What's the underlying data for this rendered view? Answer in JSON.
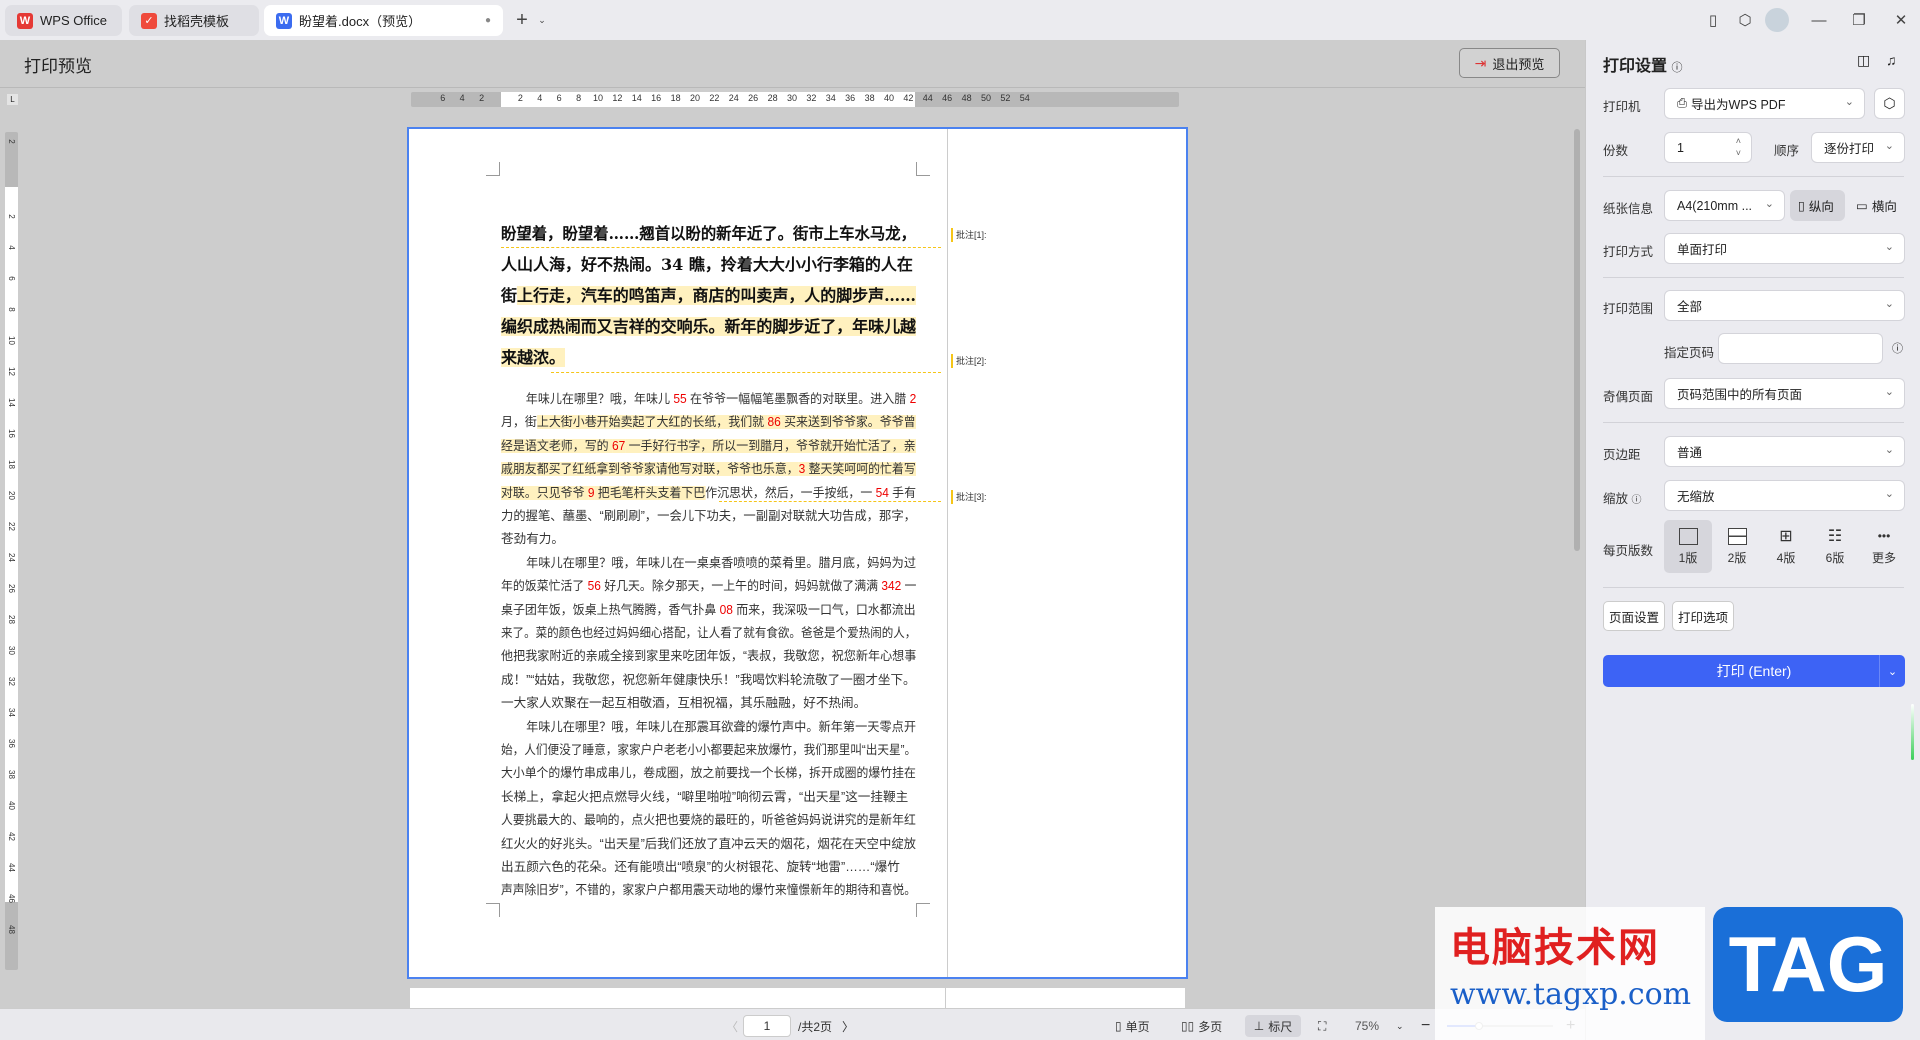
{
  "tabs": [
    {
      "label": "WPS Office",
      "icon": "wps-logo-icon"
    },
    {
      "label": "找稻壳模板",
      "icon": "docer-icon"
    },
    {
      "label": "盼望着.docx（预览）",
      "icon": "word-doc-icon",
      "active": true
    }
  ],
  "header": {
    "title": "打印预览",
    "exit_label": "退出预览"
  },
  "ruler": {
    "h_left": [
      "6",
      "4",
      "2"
    ],
    "h_main": [
      "2",
      "4",
      "6",
      "8",
      "10",
      "12",
      "14",
      "16",
      "18",
      "20",
      "22",
      "24",
      "26",
      "28",
      "30",
      "32",
      "34"
    ],
    "h_right": [
      "36",
      "38",
      "40",
      "42",
      "44",
      "46",
      "48",
      "50",
      "52",
      "54"
    ],
    "v_top": [
      "2"
    ],
    "v_main": [
      "2",
      "4",
      "6",
      "8",
      "10",
      "12",
      "14",
      "16",
      "18",
      "20",
      "22",
      "24",
      "26",
      "28",
      "30",
      "32",
      "34",
      "36",
      "38",
      "40",
      "42",
      "44",
      "46",
      "48"
    ]
  },
  "document": {
    "title_lines": [
      [
        [
          "盼望着，盼望着……翘首以盼的新年近了。街市上车水马龙，",
          ""
        ]
      ],
      [
        [
          "人山人海，好不热闹。34 瞧，拎着大大小小行李箱的人在",
          ""
        ]
      ],
      [
        [
          "街",
          ""
        ],
        [
          "上行走，汽车的鸣笛声，商店的叫卖声，人的脚步声……",
          "h"
        ]
      ],
      [
        [
          "编织成热闹而又吉祥的交响乐。新年的脚步近了，年味儿越",
          "h"
        ]
      ],
      [
        [
          "来越浓。",
          "h"
        ]
      ]
    ],
    "body_lines": [
      {
        "indent": true,
        "seg": [
          [
            "年味儿在哪里？哦，年味儿 ",
            ""
          ],
          [
            "55",
            "r"
          ],
          [
            " 在爷爷一幅幅笔墨飘香的对联里。进入腊 ",
            ""
          ],
          [
            "2",
            "r"
          ]
        ]
      },
      {
        "seg": [
          [
            "月，街",
            ""
          ],
          [
            "上大街小巷开始卖起了大红的长纸，我们就 ",
            "h"
          ],
          [
            "86",
            "rh"
          ],
          [
            " 买来送到爷爷家。爷爷曾",
            "h"
          ]
        ]
      },
      {
        "seg": [
          [
            "经是语文老师，写的 ",
            "h"
          ],
          [
            "67",
            "rh"
          ],
          [
            " 一手好行书字，所以一到腊月，爷爷就开始忙活了，亲",
            "h"
          ]
        ]
      },
      {
        "seg": [
          [
            "戚朋友都买了红纸拿到爷爷家请他写对联，爷爷也乐意，",
            "h"
          ],
          [
            "3",
            "rh"
          ],
          [
            " 整天笑呵呵的忙着写",
            "h"
          ]
        ]
      },
      {
        "seg": [
          [
            "对联。只见爷爷 ",
            "h"
          ],
          [
            "9",
            "rh"
          ],
          [
            " 把毛笔杆头支着下巴",
            "h"
          ],
          [
            "作沉思状，然后，一手按纸，一 ",
            ""
          ],
          [
            "54",
            "r"
          ],
          [
            " 手有",
            ""
          ]
        ]
      },
      {
        "seg": [
          [
            "力的握笔、蘸墨、“刷刷刷”，一会儿下功夫，一副副对联就大功告成，那字，",
            ""
          ]
        ]
      },
      {
        "last": true,
        "seg": [
          [
            "苍劲有力。",
            ""
          ]
        ]
      },
      {
        "indent": true,
        "seg": [
          [
            "年味儿在哪里？哦，年味儿在一桌桌香喷喷的菜肴里。腊月底，妈妈为过",
            ""
          ]
        ]
      },
      {
        "seg": [
          [
            "年的饭菜忙活了 ",
            ""
          ],
          [
            "56",
            "r"
          ],
          [
            " 好几天。除夕那天，一上午的时间，妈妈就做了满满 ",
            ""
          ],
          [
            "342",
            "r"
          ],
          [
            " 一",
            ""
          ]
        ]
      },
      {
        "seg": [
          [
            "桌子团年饭，饭桌上热气腾腾，香气扑鼻 ",
            ""
          ],
          [
            "08",
            "r"
          ],
          [
            " 而来，我深吸一口气，口水都流出",
            ""
          ]
        ]
      },
      {
        "seg": [
          [
            "来了。菜的颜色也经过妈妈细心搭配，让人看了就有食欲。爸爸是个爱热闹的人，",
            ""
          ]
        ]
      },
      {
        "seg": [
          [
            "他把我家附近的亲戚全接到家里来吃团年饭，“表叔，我敬您，祝您新年心想事",
            ""
          ]
        ]
      },
      {
        "seg": [
          [
            "成！”“姑姑，我敬您，祝您新年健康快乐！”我喝饮料轮流敬了一圈才坐下。",
            ""
          ]
        ]
      },
      {
        "last": true,
        "seg": [
          [
            "一大家人欢聚在一起互相敬酒，互相祝福，其乐融融，好不热闹。",
            ""
          ]
        ]
      },
      {
        "indent": true,
        "seg": [
          [
            "年味儿在哪里？哦，年味儿在那震耳欲聋的爆竹声中。新年第一天零点开",
            ""
          ]
        ]
      },
      {
        "seg": [
          [
            "始，人们便没了睡意，家家户户老老小小都要起来放爆竹，我们那里叫“出天星”。",
            ""
          ]
        ]
      },
      {
        "seg": [
          [
            "大小单个的爆竹串成串儿，卷成圈，放之前要找一个长梯，拆开成圈的爆竹挂在",
            ""
          ]
        ]
      },
      {
        "seg": [
          [
            "长梯上，拿起火把点燃导火线，“噼里啪啦”响彻云霄，“出天星”这一挂鞭主",
            ""
          ]
        ]
      },
      {
        "seg": [
          [
            "人要挑最大的、最响的，点火把也要烧的最旺的，听爸爸妈妈说讲究的是新年红",
            ""
          ]
        ]
      },
      {
        "seg": [
          [
            "红火火的好兆头。“出天星”后我们还放了直冲云天的烟花，烟花在天空中绽放",
            ""
          ]
        ]
      },
      {
        "seg": [
          [
            "出五颜六色的花朵。还有能喷出“喷泉”的火树银花、旋转“地雷”……“爆竹",
            ""
          ]
        ]
      },
      {
        "seg": [
          [
            "声声除旧岁”，不错的，家家户户都用震天动地的爆竹来憧憬新年的期待和喜悦。",
            ""
          ]
        ]
      }
    ],
    "comments": [
      "批注[1]:",
      "批注[2]:",
      "批注[3]:"
    ]
  },
  "status": {
    "page_value": "1",
    "page_total": "/共2页",
    "single_label": "单页",
    "multi_label": "多页",
    "ruler_label": "标尺",
    "zoom": "75%",
    "zoom_fraction": 0.3
  },
  "panel": {
    "title": "打印设置",
    "printer_label": "打印机",
    "printer_value": "导出为WPS PDF",
    "copies_label": "份数",
    "copies_value": "1",
    "order_label": "顺序",
    "order_value": "逐份打印",
    "paper_label": "纸张信息",
    "paper_value": "A4(210mm ...",
    "portrait_label": "纵向",
    "landscape_label": "横向",
    "mode_label": "打印方式",
    "mode_value": "单面打印",
    "range_label": "打印范围",
    "range_value": "全部",
    "pages_label": "指定页码",
    "pages_value": "",
    "oddeven_label": "奇偶页面",
    "oddeven_value": "页码范围中的所有页面",
    "margin_label": "页边距",
    "margin_value": "普通",
    "scale_label": "缩放",
    "scale_value": "无缩放",
    "perpage_label": "每页版数",
    "layouts": [
      "1版",
      "2版",
      "4版",
      "6版",
      "更多"
    ],
    "page_setup_label": "页面设置",
    "print_options_label": "打印选项",
    "print_label": "打印 (Enter)"
  },
  "watermark": {
    "cn": "电脑技术网",
    "url": "www.tagxp.com",
    "tag": "TAG"
  },
  "colors": {
    "accent": "#3d63f5",
    "highlight": "#fff1bf",
    "number_red": "#e00000",
    "comment_line": "#f5c518"
  }
}
